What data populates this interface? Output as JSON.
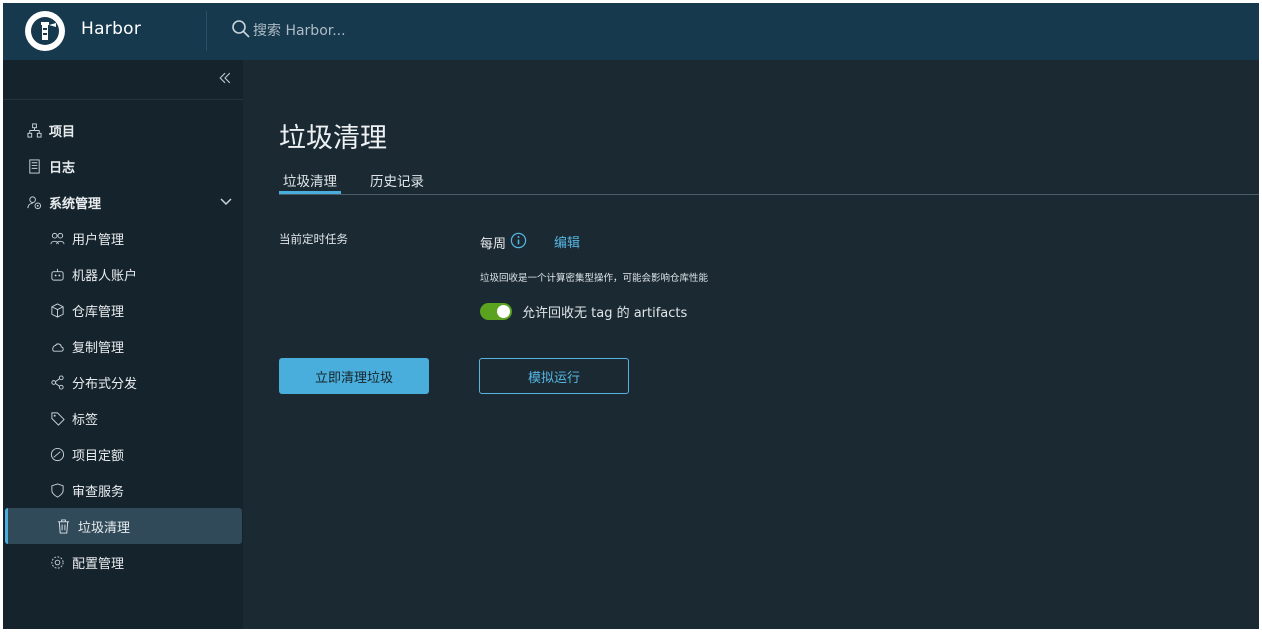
{
  "header": {
    "brand": "Harbor",
    "search_placeholder": "搜索 Harbor...",
    "logo_icon": "harbor-lighthouse-logo",
    "search_icon": "search-icon"
  },
  "sidebar": {
    "collapse_icon": "double-chevron-left-icon",
    "top_items": [
      {
        "label": "项目",
        "icon": "projects-icon"
      },
      {
        "label": "日志",
        "icon": "log-icon"
      },
      {
        "label": "系统管理",
        "icon": "admin-icon",
        "expanded": true
      }
    ],
    "sub_items": [
      {
        "label": "用户管理",
        "icon": "users-icon"
      },
      {
        "label": "机器人账户",
        "icon": "robot-icon"
      },
      {
        "label": "仓库管理",
        "icon": "registry-icon"
      },
      {
        "label": "复制管理",
        "icon": "cloud-sync-icon"
      },
      {
        "label": "分布式分发",
        "icon": "share-icon"
      },
      {
        "label": "标签",
        "icon": "tag-icon"
      },
      {
        "label": "项目定额",
        "icon": "quota-icon"
      },
      {
        "label": "审查服务",
        "icon": "shield-icon"
      },
      {
        "label": "垃圾清理",
        "icon": "trash-icon",
        "active": true
      },
      {
        "label": "配置管理",
        "icon": "gear-icon"
      }
    ]
  },
  "main": {
    "title": "垃圾清理",
    "tabs": [
      {
        "label": "垃圾清理",
        "active": true
      },
      {
        "label": "历史记录",
        "active": false
      }
    ],
    "schedule_label": "当前定时任务",
    "schedule_value": "每周",
    "edit_label": "编辑",
    "help_text": "垃圾回收是一个计算密集型操作，可能会影响仓库性能",
    "toggle_label": "允许回收无 tag 的 artifacts",
    "toggle_on": true,
    "gc_now_label": "立即清理垃圾",
    "dry_run_label": "模拟运行"
  },
  "colors": {
    "header_bg": "#17394e",
    "sidebar_bg": "#15242c",
    "main_bg": "#1b2a32",
    "accent": "#49aedb",
    "toggle_on": "#5aa220"
  }
}
